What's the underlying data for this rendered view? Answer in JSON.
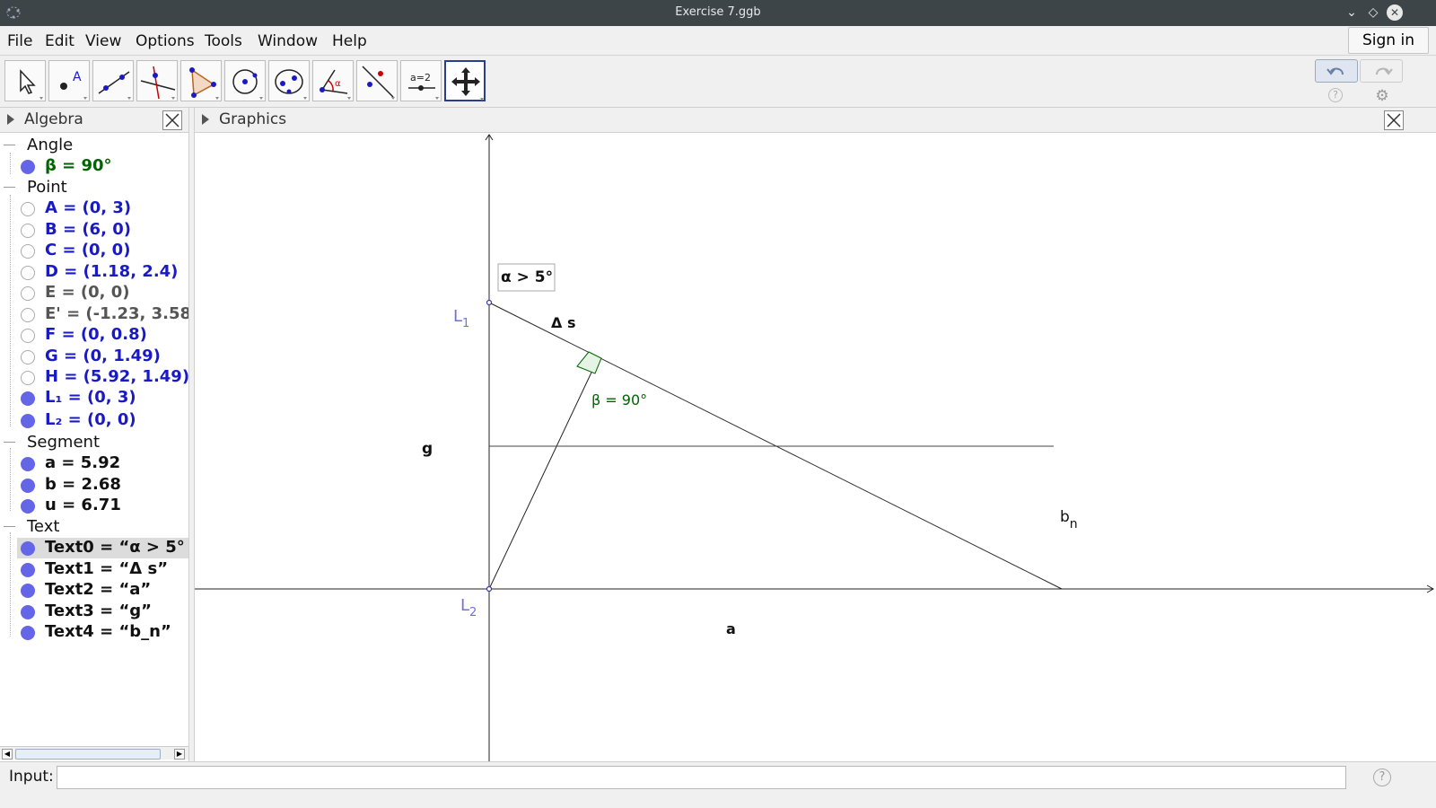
{
  "window": {
    "title": "Exercise 7.ggb"
  },
  "menu": {
    "items": [
      "File",
      "Edit",
      "View",
      "Options",
      "Tools",
      "Window",
      "Help"
    ],
    "sign_in": "Sign in"
  },
  "toolbar": {
    "tools": [
      {
        "icon": "move-arrow-icon"
      },
      {
        "icon": "point-icon"
      },
      {
        "icon": "line-icon"
      },
      {
        "icon": "perpendicular-line-icon"
      },
      {
        "icon": "polygon-icon"
      },
      {
        "icon": "circle-icon"
      },
      {
        "icon": "ellipse-icon"
      },
      {
        "icon": "angle-icon"
      },
      {
        "icon": "reflect-icon"
      },
      {
        "icon": "slider-icon",
        "label": "a=2"
      },
      {
        "icon": "move-graphics-view-icon",
        "selected": true
      }
    ]
  },
  "algebra": {
    "title": "Algebra",
    "groups": [
      {
        "name": "Angle",
        "items": [
          {
            "text": "β = 90°",
            "color": "#006400",
            "visible": true
          }
        ]
      },
      {
        "name": "Point",
        "items": [
          {
            "text": "A = (0, 3)",
            "color": "#1a1ac4",
            "visible": false
          },
          {
            "text": "B = (6, 0)",
            "color": "#1a1ac4",
            "visible": false
          },
          {
            "text": "C = (0, 0)",
            "color": "#1a1ac4",
            "visible": false
          },
          {
            "text": "D = (1.18, 2.4)",
            "color": "#1a1ac4",
            "visible": false
          },
          {
            "text": "E = (0, 0)",
            "color": "#555555",
            "visible": false
          },
          {
            "text": "E' = (-1.23, 3.58",
            "color": "#555555",
            "visible": false
          },
          {
            "text": "F = (0, 0.8)",
            "color": "#1a1ac4",
            "visible": false
          },
          {
            "text": "G = (0, 1.49)",
            "color": "#1a1ac4",
            "visible": false
          },
          {
            "text": "H = (5.92, 1.49)",
            "color": "#1a1ac4",
            "visible": false
          },
          {
            "text": "L₁ = (0, 3)",
            "color": "#1a1ac4",
            "visible": true
          },
          {
            "text": "L₂ = (0, 0)",
            "color": "#1a1ac4",
            "visible": true
          }
        ]
      },
      {
        "name": "Segment",
        "items": [
          {
            "text": "a = 5.92",
            "color": "#111111",
            "visible": true
          },
          {
            "text": "b = 2.68",
            "color": "#111111",
            "visible": true
          },
          {
            "text": "u = 6.71",
            "color": "#111111",
            "visible": true
          }
        ]
      },
      {
        "name": "Text",
        "items": [
          {
            "text": "Text0 = “α > 5°",
            "color": "#111111",
            "visible": true,
            "selected": true
          },
          {
            "text": "Text1 = “Δ s”",
            "color": "#111111",
            "visible": true
          },
          {
            "text": "Text2 = “a”",
            "color": "#111111",
            "visible": true
          },
          {
            "text": "Text3 = “g”",
            "color": "#111111",
            "visible": true
          },
          {
            "text": "Text4 = “b_n”",
            "color": "#111111",
            "visible": true
          }
        ]
      }
    ]
  },
  "graphics": {
    "title": "Graphics",
    "labels": {
      "alpha_box": "α > 5°",
      "delta_s": "Δ s",
      "beta": "β = 90°",
      "g": "g",
      "a": "a",
      "b": "b",
      "b_sub": "n",
      "L": "L",
      "L1_sub": "1",
      "L2_sub": "2"
    },
    "colors": {
      "angle": "#006400",
      "point_label": "#6f6fe0",
      "angle_fill": "#e6f4e6"
    }
  },
  "input": {
    "label": "Input:",
    "value": "",
    "help": "?"
  }
}
